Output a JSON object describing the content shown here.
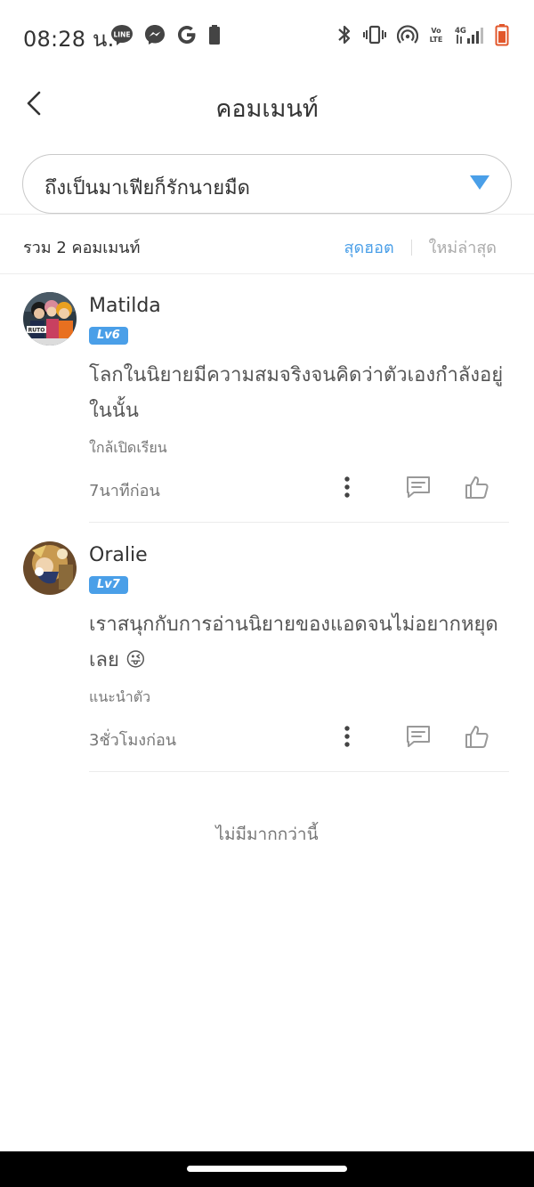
{
  "status_bar": {
    "time": "08:28 น.",
    "left_icons": [
      "line-icon",
      "messenger-icon",
      "google-icon",
      "battery-saver-icon"
    ],
    "right_icons": [
      "bluetooth-icon",
      "vibrate-icon",
      "hotspot-icon",
      "volte-icon",
      "signal-icon",
      "battery-icon"
    ],
    "volte_label": "Vo\nLTE",
    "network_label": "4G"
  },
  "header": {
    "title": "คอมเมนท์"
  },
  "selector": {
    "value": "ถึงเป็นมาเฟียก็รักนายมืด"
  },
  "summary": {
    "count_text": "รวม 2 คอมเมนท์",
    "sort_tabs": [
      {
        "label": "สุดฮอต",
        "active": true
      },
      {
        "label": "ใหม่ล่าสุด",
        "active": false
      }
    ]
  },
  "comments": [
    {
      "username": "Matilda",
      "level": "Lv6",
      "text": "โลกในนิยายมีความสมจริงจนคิดว่าตัวเองกำลังอยู่ในนั้น",
      "tag": "ใกล้เปิดเรียน",
      "time": "7นาทีก่อน"
    },
    {
      "username": "Oralie",
      "level": "Lv7",
      "text": "เราสนุกกับการอ่านนิยายของแอดจนไม่อยากหยุดเลย 😜",
      "tag": "แนะนำตัว",
      "time": "3ชั่วโมงก่อน"
    }
  ],
  "footer": {
    "no_more_text": "ไม่มีมากกว่านี้"
  },
  "colors": {
    "accent": "#4a9fe8",
    "text": "#333333",
    "muted": "#777777"
  }
}
